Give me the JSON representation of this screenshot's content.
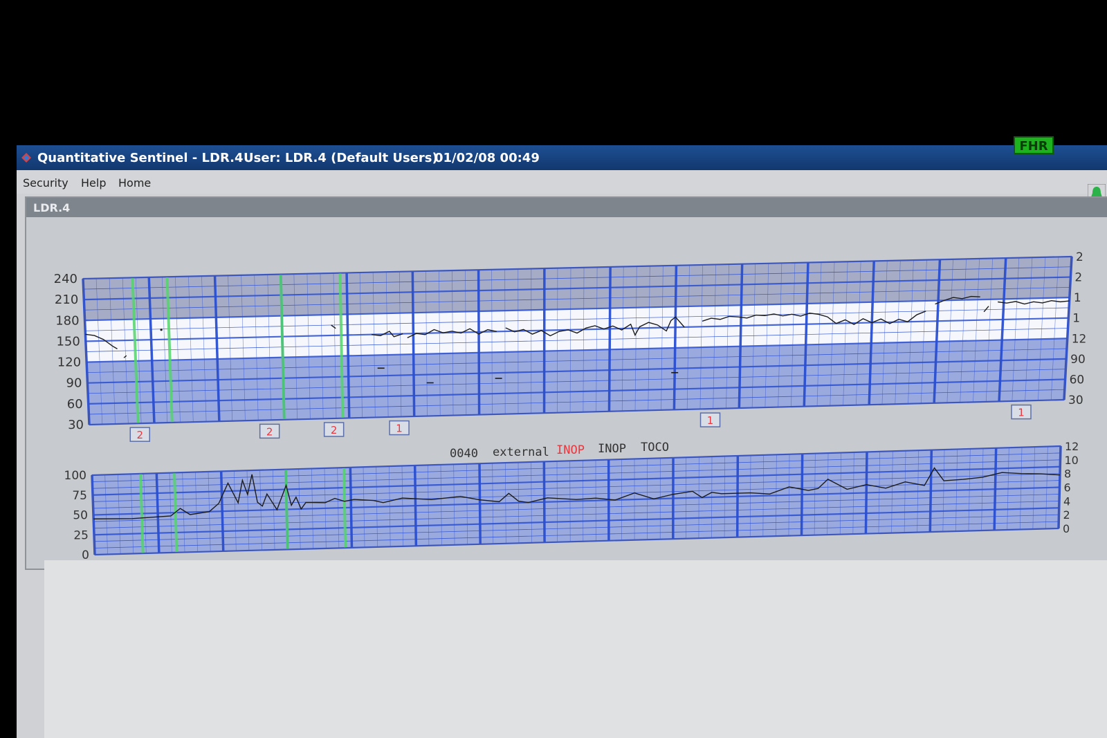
{
  "window": {
    "title": "Quantitative Sentinel - LDR.4",
    "user": "User: LDR.4 (Default Users)",
    "datetime": "01/02/08 00:49",
    "badge": "FHR"
  },
  "menu": {
    "items": [
      "Security",
      "Help",
      "Home"
    ]
  },
  "panel": {
    "title": "LDR.4"
  },
  "status_line": {
    "code": "0040",
    "mode": "external",
    "inop_red": "INOP",
    "inop": "INOP",
    "toco": "TOCO"
  },
  "colors": {
    "grid": "#2a4fd0",
    "inop": "#e8383f",
    "marker_green": "#53d66b",
    "trace": "#1b1b1b",
    "normal_band": "#ffffff"
  },
  "chart_data": [
    {
      "type": "line",
      "title": "",
      "ylim": [
        30,
        240
      ],
      "yticks": [
        240,
        210,
        180,
        150,
        120,
        90,
        60,
        30
      ],
      "right_ticks": [
        "2",
        "2",
        "1",
        "1",
        "12",
        "90",
        "60",
        "30"
      ],
      "normal_band": [
        120,
        180
      ],
      "annotations": [
        {
          "label": "2",
          "x": 0.052
        },
        {
          "label": "2",
          "x": 0.185
        },
        {
          "label": "2",
          "x": 0.251
        },
        {
          "label": "1",
          "x": 0.318
        },
        {
          "label": "1",
          "x": 0.637
        },
        {
          "label": "1",
          "x": 0.956
        }
      ],
      "green_markers": [
        0.05,
        0.085,
        0.2,
        0.26
      ],
      "segments": [
        [
          [
            0.0,
            160
          ],
          [
            0.01,
            158
          ],
          [
            0.02,
            152
          ],
          [
            0.03,
            142
          ],
          [
            0.035,
            138
          ]
        ],
        [
          [
            0.042,
            125
          ],
          [
            0.045,
            128
          ]
        ],
        [
          [
            0.085,
            164
          ]
        ],
        [
          [
            0.275,
            165
          ],
          [
            0.28,
            160
          ]
        ],
        [
          [
            0.32,
            150
          ],
          [
            0.33,
            148
          ],
          [
            0.34,
            154
          ],
          [
            0.345,
            146
          ],
          [
            0.355,
            150
          ]
        ],
        [
          [
            0.36,
            144
          ],
          [
            0.37,
            150
          ],
          [
            0.38,
            148
          ],
          [
            0.39,
            155
          ],
          [
            0.4,
            150
          ],
          [
            0.41,
            152
          ],
          [
            0.42,
            149
          ],
          [
            0.43,
            155
          ],
          [
            0.44,
            147
          ],
          [
            0.45,
            153
          ],
          [
            0.46,
            150
          ]
        ],
        [
          [
            0.47,
            155
          ],
          [
            0.48,
            149
          ],
          [
            0.49,
            152
          ],
          [
            0.5,
            145
          ],
          [
            0.51,
            150
          ],
          [
            0.52,
            142
          ],
          [
            0.53,
            148
          ],
          [
            0.54,
            150
          ],
          [
            0.55,
            145
          ],
          [
            0.56,
            152
          ],
          [
            0.57,
            155
          ],
          [
            0.58,
            150
          ],
          [
            0.59,
            154
          ],
          [
            0.6,
            148
          ],
          [
            0.61,
            156
          ],
          [
            0.615,
            140
          ],
          [
            0.62,
            152
          ],
          [
            0.63,
            158
          ],
          [
            0.64,
            154
          ],
          [
            0.65,
            145
          ],
          [
            0.655,
            160
          ],
          [
            0.66,
            165
          ],
          [
            0.67,
            150
          ]
        ],
        [
          [
            0.69,
            158
          ],
          [
            0.7,
            162
          ],
          [
            0.71,
            160
          ],
          [
            0.72,
            164
          ],
          [
            0.73,
            163
          ],
          [
            0.74,
            161
          ],
          [
            0.75,
            165
          ],
          [
            0.76,
            164
          ],
          [
            0.77,
            166
          ],
          [
            0.78,
            163
          ],
          [
            0.79,
            165
          ],
          [
            0.8,
            162
          ],
          [
            0.81,
            166
          ],
          [
            0.82,
            164
          ],
          [
            0.83,
            160
          ],
          [
            0.84,
            150
          ],
          [
            0.85,
            155
          ],
          [
            0.86,
            148
          ],
          [
            0.87,
            156
          ],
          [
            0.88,
            150
          ],
          [
            0.89,
            155
          ],
          [
            0.9,
            148
          ],
          [
            0.91,
            154
          ],
          [
            0.92,
            150
          ],
          [
            0.93,
            160
          ],
          [
            0.94,
            165
          ]
        ],
        [
          [
            0.95,
            175
          ],
          [
            0.96,
            180
          ],
          [
            0.97,
            184
          ],
          [
            0.98,
            182
          ],
          [
            0.99,
            185
          ],
          [
            1.0,
            184
          ]
        ],
        [
          [
            1.005,
            162
          ],
          [
            1.01,
            170
          ]
        ],
        [
          [
            1.02,
            176
          ],
          [
            1.03,
            174
          ],
          [
            1.04,
            176
          ],
          [
            1.05,
            172
          ],
          [
            1.06,
            175
          ],
          [
            1.07,
            173
          ],
          [
            1.08,
            176
          ],
          [
            1.09,
            174
          ],
          [
            1.1,
            175
          ]
        ]
      ],
      "dropout_points": [
        [
          0.3,
          101
        ],
        [
          0.35,
          78
        ],
        [
          0.42,
          82
        ],
        [
          0.6,
          84
        ]
      ]
    },
    {
      "type": "line",
      "title": "",
      "ylim": [
        0,
        100
      ],
      "yticks": [
        100,
        75,
        50,
        25,
        0
      ],
      "right_ticks": [
        "12",
        "10",
        "8",
        "6",
        "4",
        "2",
        "0"
      ],
      "green_markers": [
        0.05,
        0.085,
        0.2,
        0.26
      ],
      "x": [
        0.0,
        0.04,
        0.08,
        0.09,
        0.1,
        0.12,
        0.13,
        0.14,
        0.15,
        0.155,
        0.16,
        0.165,
        0.17,
        0.175,
        0.18,
        0.19,
        0.2,
        0.205,
        0.21,
        0.215,
        0.22,
        0.24,
        0.25,
        0.26,
        0.27,
        0.29,
        0.3,
        0.32,
        0.35,
        0.38,
        0.4,
        0.42,
        0.43,
        0.44,
        0.45,
        0.47,
        0.5,
        0.52,
        0.54,
        0.56,
        0.58,
        0.6,
        0.62,
        0.63,
        0.64,
        0.65,
        0.68,
        0.7,
        0.72,
        0.74,
        0.75,
        0.76,
        0.78,
        0.8,
        0.82,
        0.84,
        0.86,
        0.87,
        0.88,
        0.9,
        0.92,
        0.94,
        0.96,
        0.98,
        1.0
      ],
      "values": [
        45,
        44,
        46,
        55,
        47,
        50,
        60,
        85,
        60,
        88,
        70,
        95,
        60,
        55,
        70,
        50,
        80,
        55,
        65,
        50,
        58,
        57,
        62,
        58,
        60,
        58,
        55,
        60,
        57,
        60,
        55,
        52,
        62,
        52,
        50,
        55,
        52,
        53,
        50,
        58,
        50,
        55,
        58,
        50,
        56,
        54,
        54,
        52,
        60,
        55,
        57,
        68,
        55,
        60,
        55,
        62,
        57,
        78,
        62,
        63,
        65,
        70,
        68,
        67,
        65
      ]
    }
  ]
}
